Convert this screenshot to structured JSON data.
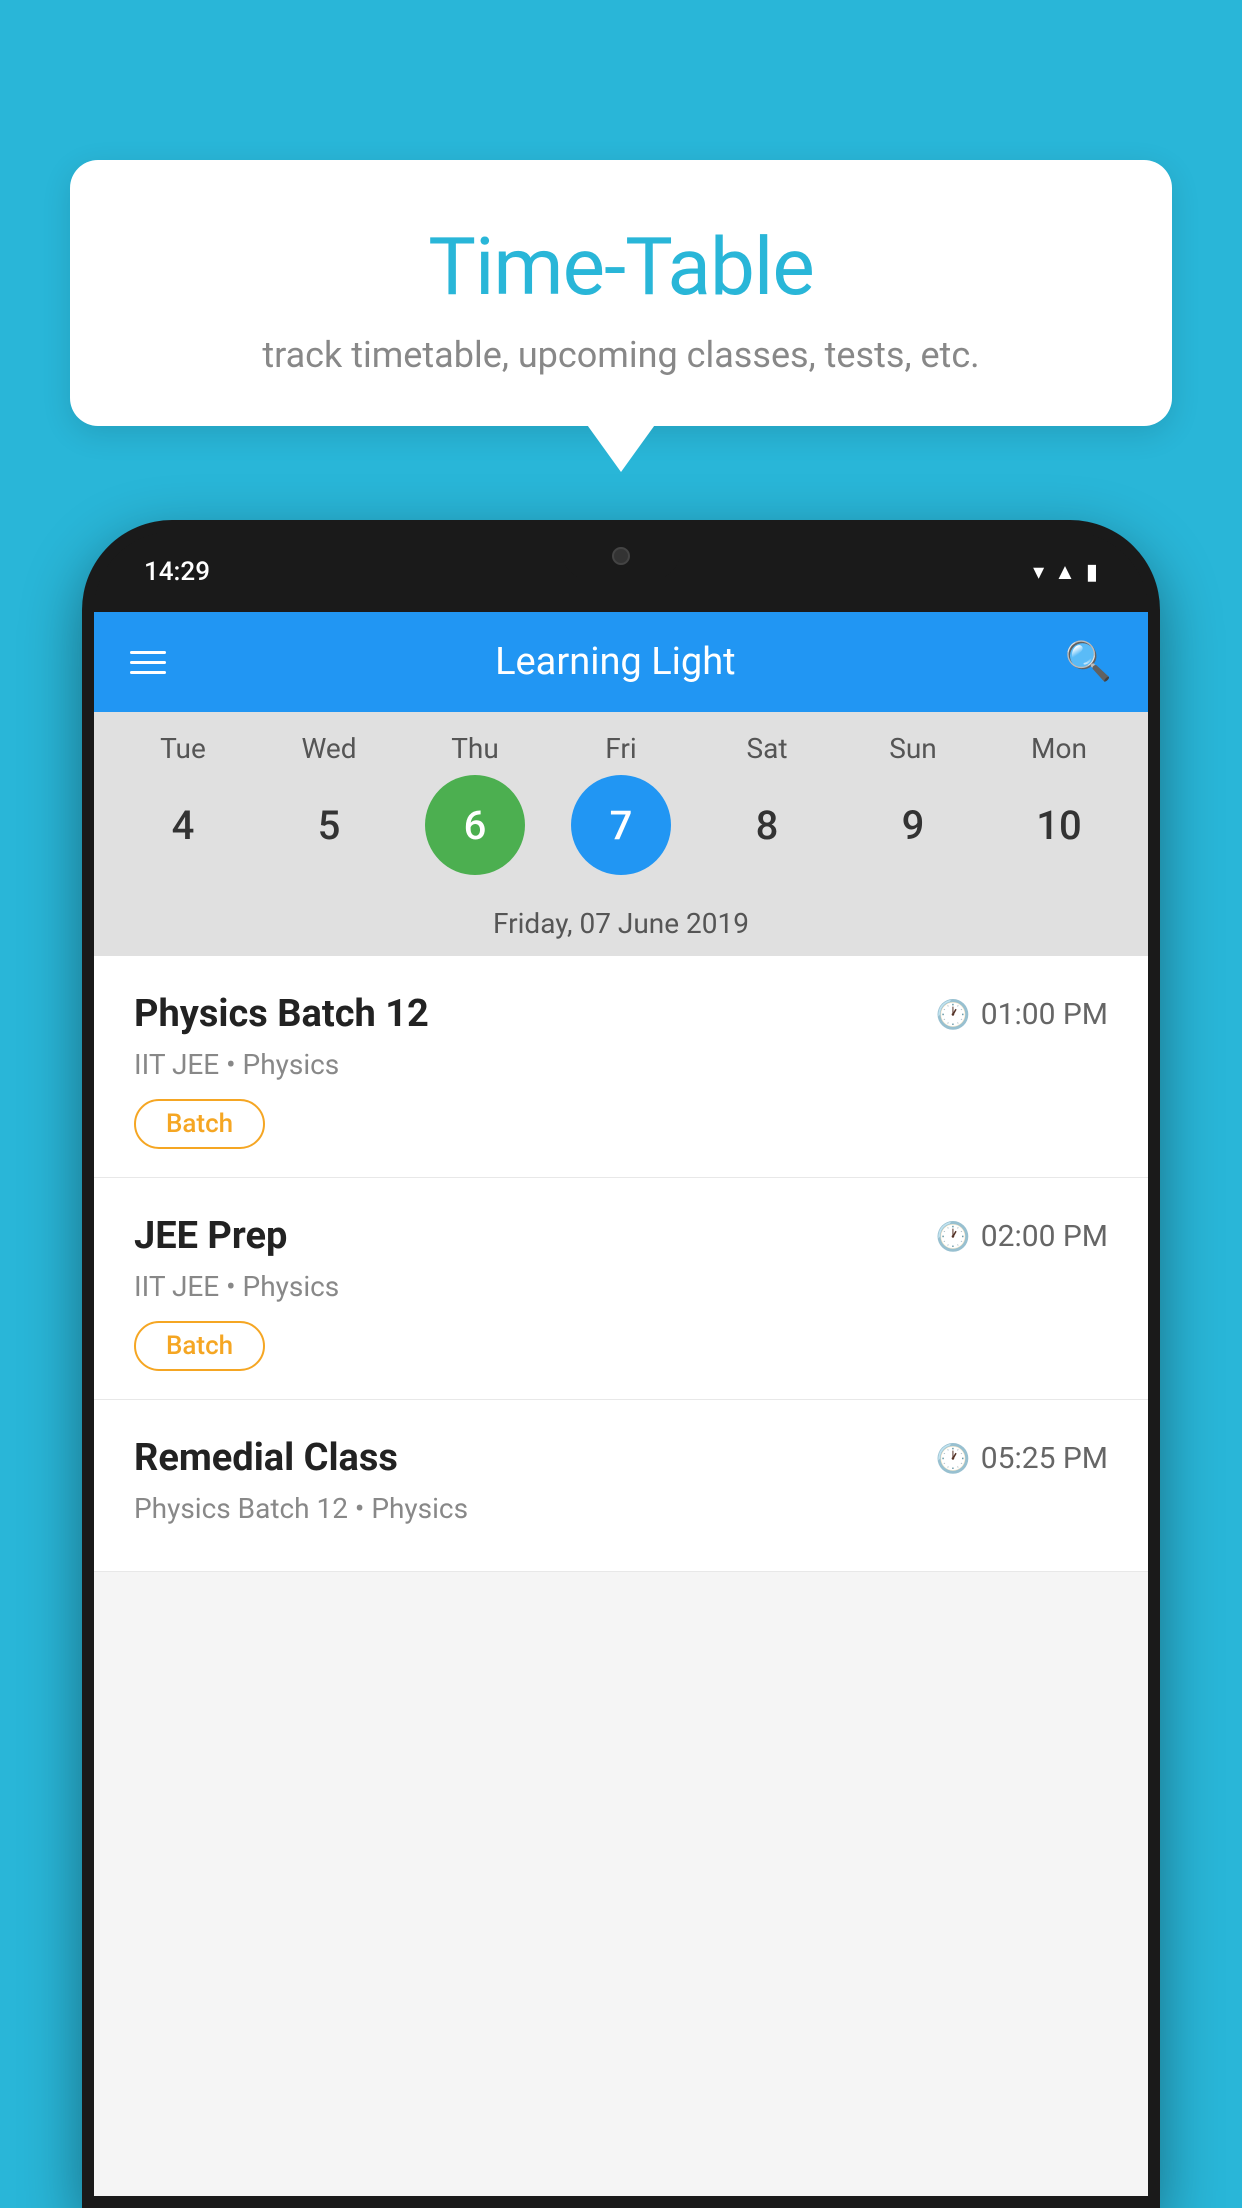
{
  "background_color": "#29b6d8",
  "tooltip": {
    "title": "Time-Table",
    "subtitle": "track timetable, upcoming classes, tests, etc."
  },
  "phone": {
    "time": "14:29",
    "app_name": "Learning Light",
    "selected_date_label": "Friday, 07 June 2019",
    "days": [
      {
        "name": "Tue",
        "num": "4",
        "state": "normal"
      },
      {
        "name": "Wed",
        "num": "5",
        "state": "normal"
      },
      {
        "name": "Thu",
        "num": "6",
        "state": "today"
      },
      {
        "name": "Fri",
        "num": "7",
        "state": "selected"
      },
      {
        "name": "Sat",
        "num": "8",
        "state": "normal"
      },
      {
        "name": "Sun",
        "num": "9",
        "state": "normal"
      },
      {
        "name": "Mon",
        "num": "10",
        "state": "normal"
      }
    ],
    "schedule_items": [
      {
        "title": "Physics Batch 12",
        "time": "01:00 PM",
        "meta": "IIT JEE • Physics",
        "badge": "Batch"
      },
      {
        "title": "JEE Prep",
        "time": "02:00 PM",
        "meta": "IIT JEE • Physics",
        "badge": "Batch"
      },
      {
        "title": "Remedial Class",
        "time": "05:25 PM",
        "meta": "Physics Batch 12 • Physics",
        "badge": null
      }
    ]
  }
}
